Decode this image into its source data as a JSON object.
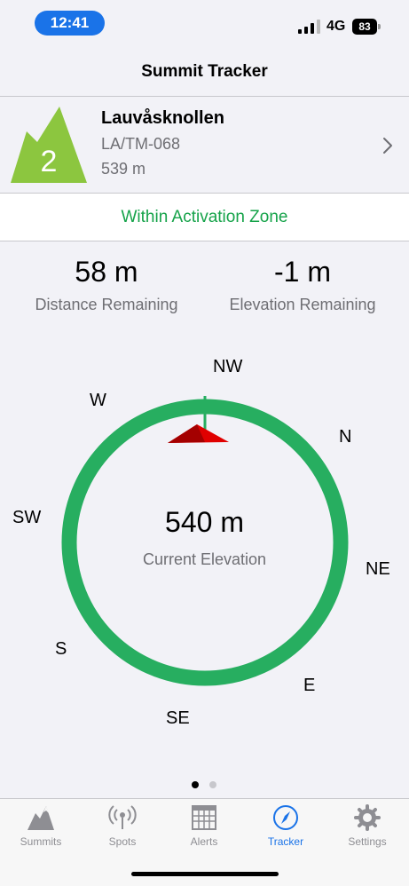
{
  "status_bar": {
    "time": "12:41",
    "network": "4G",
    "battery": "83"
  },
  "nav": {
    "title": "Summit Tracker"
  },
  "summit": {
    "points": "2",
    "name": "Lauvåsknollen",
    "reference": "LA/TM-068",
    "altitude": "539 m",
    "mountain_color": "#8cc63f"
  },
  "zone": {
    "status": "Within Activation Zone",
    "color": "#16a34a"
  },
  "stats": {
    "distance": {
      "value": "58 m",
      "label": "Distance Remaining"
    },
    "elevation": {
      "value": "-1 m",
      "label": "Elevation Remaining"
    }
  },
  "compass": {
    "directions": {
      "nw": "NW",
      "n": "N",
      "ne": "NE",
      "e": "E",
      "se": "SE",
      "s": "S",
      "sw": "SW",
      "w": "W"
    },
    "current_elevation": "540 m",
    "current_elevation_label": "Current Elevation",
    "ring_color": "#27ae60",
    "pointer_color": "#e00000"
  },
  "pager": {
    "pages": 2,
    "active": 1
  },
  "tabs": [
    {
      "label": "Summits",
      "icon": "mountain-icon",
      "active": false
    },
    {
      "label": "Spots",
      "icon": "antenna-icon",
      "active": false
    },
    {
      "label": "Alerts",
      "icon": "calendar-icon",
      "active": false
    },
    {
      "label": "Tracker",
      "icon": "compass-icon",
      "active": true
    },
    {
      "label": "Settings",
      "icon": "gear-icon",
      "active": false
    }
  ]
}
